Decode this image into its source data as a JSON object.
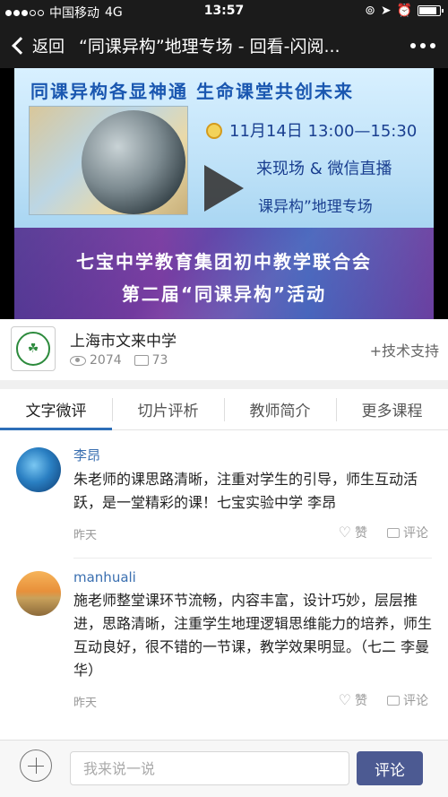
{
  "status_bar": {
    "carrier": "中国移动",
    "network": "4G",
    "time": "13:57"
  },
  "nav": {
    "back_label": "返回",
    "title": "“同课异构”地理专场 - 回看-闪阅..."
  },
  "video": {
    "headline": "同课异构各显神通  生命课堂共创未来",
    "time_text": "11月14日  13:00—15:30",
    "live_text": "来现场 & 微信直播",
    "topic_text": "课异构”地理专场",
    "title_line1": "七宝中学教育集团初中教学联合会",
    "title_line2": "第二届“同课异构”活动"
  },
  "school": {
    "name": "上海市文来中学",
    "views": "2074",
    "comments": "73",
    "support_label": "+技术支持"
  },
  "tabs": [
    {
      "label": "文字微评",
      "active": true
    },
    {
      "label": "切片评析",
      "active": false
    },
    {
      "label": "教师简介",
      "active": false
    },
    {
      "label": "更多课程",
      "active": false
    }
  ],
  "comments": [
    {
      "author": "李昂",
      "text": "朱老师的课思路清晰，注重对学生的引导，师生互动活跃，是一堂精彩的课！七宝实验中学  李昂",
      "time": "昨天",
      "like_label": "赞",
      "reply_label": "评论"
    },
    {
      "author": "manhuali",
      "text": "施老师整堂课环节流畅，内容丰富，设计巧妙，层层推进，思路清晰，注重学生地理逻辑思维能力的培养，师生互动良好，很不错的一节课，教学效果明显。（七二  李曼华）",
      "time": "昨天",
      "like_label": "赞",
      "reply_label": "评论"
    }
  ],
  "input_bar": {
    "placeholder": "我来说一说",
    "submit_label": "评论"
  },
  "colors": {
    "accent": "#2d6eb8",
    "submit": "#4c5a92",
    "author": "#3a6fb0"
  }
}
